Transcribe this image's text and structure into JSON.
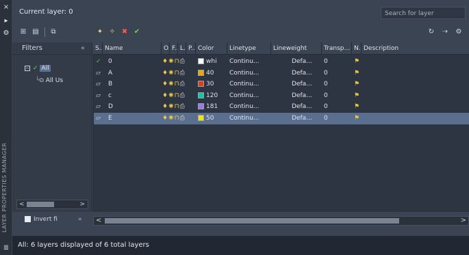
{
  "window": {
    "vertical_title": "LAYER PROPERTIES MANAGER",
    "close_glyph": "×",
    "autohide_glyph": "▸",
    "props_glyph": "⚙"
  },
  "header": {
    "current_layer": "Current layer: 0",
    "search_placeholder": "Search for layer"
  },
  "toolbar": {
    "icons": [
      "new-property-filter-icon",
      "new-group-filter-icon",
      "layer-states-manager-icon",
      "new-layer-icon",
      "new-layer-vp-frozen-icon",
      "delete-layer-icon",
      "set-current-icon",
      "refresh-icon",
      "settings-icon",
      "gear-icon"
    ]
  },
  "filters": {
    "header": "Filters",
    "collapse": "«",
    "tree": [
      {
        "label": "All",
        "expander": "⊟",
        "selected": true
      },
      {
        "label": "All Us",
        "expander": "",
        "selected": false
      }
    ],
    "invert_label": "Invert fi",
    "invert_collapse": "«"
  },
  "grid": {
    "columns": [
      "S..",
      "Name",
      "O..",
      "F..",
      "L..",
      "P..",
      "Color",
      "Linetype",
      "Lineweight",
      "Transp...",
      "N..",
      "Description"
    ],
    "rows": [
      {
        "status": "current",
        "name": "0",
        "color_name": "whi",
        "color_hex": "#ffffff",
        "linetype": "Continu...",
        "lineweight": "Defa...",
        "transparency": "0",
        "selected": false
      },
      {
        "status": "layer",
        "name": "A",
        "color_name": "40",
        "color_hex": "#f5a300",
        "linetype": "Continu...",
        "lineweight": "Defa...",
        "transparency": "0",
        "selected": false
      },
      {
        "status": "layer",
        "name": "B",
        "color_name": "30",
        "color_hex": "#e83a14",
        "linetype": "Continu...",
        "lineweight": "Defa...",
        "transparency": "0",
        "selected": false
      },
      {
        "status": "layer",
        "name": "c",
        "color_name": "120",
        "color_hex": "#10c9a6",
        "linetype": "Continu...",
        "lineweight": "Defa...",
        "transparency": "0",
        "selected": false
      },
      {
        "status": "layer",
        "name": "D",
        "color_name": "181",
        "color_hex": "#9a7be6",
        "linetype": "Continu...",
        "lineweight": "Defa...",
        "transparency": "0",
        "selected": false
      },
      {
        "status": "layer",
        "name": "E",
        "color_name": "50",
        "color_hex": "#f2e10b",
        "linetype": "Continu...",
        "lineweight": "Defa...",
        "transparency": "0",
        "selected": true
      }
    ],
    "scroll_left": "<",
    "scroll_right": ">"
  },
  "status_bar": {
    "text": "All: 6 layers displayed of 6 total layers"
  }
}
